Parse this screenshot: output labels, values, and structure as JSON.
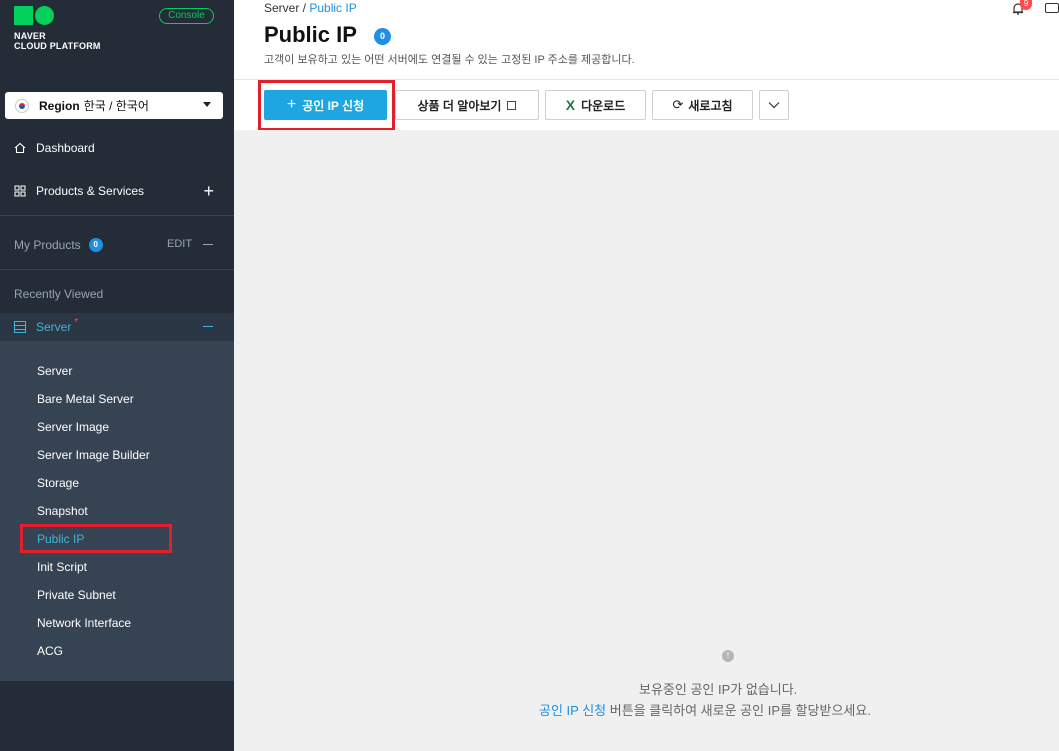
{
  "sidebar": {
    "logo_line1": "NAVER",
    "logo_line2": "CLOUD PLATFORM",
    "console_label": "Console",
    "region_label": "Region",
    "region_value": "한국 / 한국어",
    "dashboard_label": "Dashboard",
    "products_label": "Products & Services",
    "my_products_label": "My Products",
    "my_products_count": "0",
    "edit_label": "EDIT",
    "recently_viewed_label": "Recently Viewed",
    "server_group_label": "Server",
    "server_group_mark": "*",
    "items": [
      {
        "label": "Server"
      },
      {
        "label": "Bare Metal Server"
      },
      {
        "label": "Server Image"
      },
      {
        "label": "Server Image Builder"
      },
      {
        "label": "Storage"
      },
      {
        "label": "Snapshot"
      },
      {
        "label": "Public IP"
      },
      {
        "label": "Init Script"
      },
      {
        "label": "Private Subnet"
      },
      {
        "label": "Network Interface"
      },
      {
        "label": "ACG"
      }
    ]
  },
  "header": {
    "breadcrumb_root": "Server /",
    "breadcrumb_current": "Public IP",
    "title": "Public IP",
    "title_count": "0",
    "subtitle": "고객이 보유하고 있는 어떤 서버에도 연결될 수 있는 고정된 IP 주소를 제공합니다.",
    "notification_count": "9"
  },
  "toolbar": {
    "apply_label": "공인 IP 신청",
    "learn_more_label": "상품 더 알아보기",
    "download_label": "다운로드",
    "refresh_label": "새로고침"
  },
  "empty_state": {
    "icon_text": "!",
    "line1": "보유중인 공인 IP가 없습니다.",
    "line2_link": "공인 IP 신청",
    "line2_rest": " 버튼을 클릭하여 새로운 공인 IP를 할당받으세요."
  }
}
